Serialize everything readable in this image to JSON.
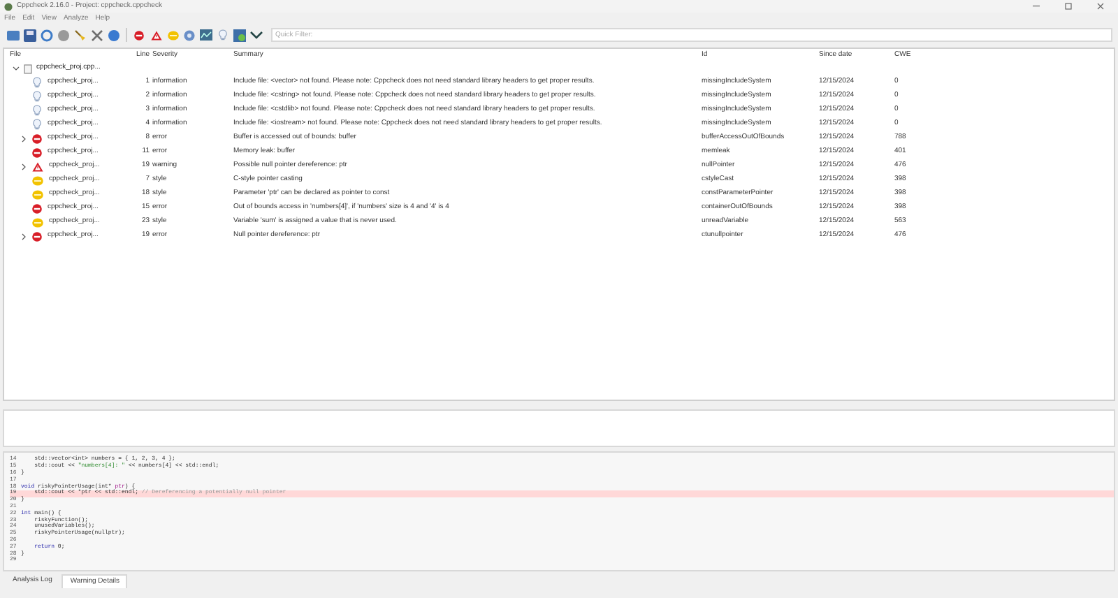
{
  "window": {
    "title": "Cppcheck 2.16.0 - Project: cppcheck.cppcheck"
  },
  "menu": [
    "File",
    "Edit",
    "View",
    "Analyze",
    "Help"
  ],
  "quick_filter": {
    "placeholder": "Quick Filter:"
  },
  "table": {
    "columns": [
      "File",
      "Line",
      "Severity",
      "Summary",
      "Id",
      "Since date",
      "CWE"
    ],
    "group": {
      "file": "cppcheck_proj.cpp...",
      "expanded": true
    },
    "rows": [
      {
        "kind": "information",
        "expandable": false,
        "file": "cppcheck_proj...",
        "line": "1",
        "severity": "information",
        "summary": "Include file: <vector> not found. Please note: Cppcheck does not need standard library headers to get proper results.",
        "id": "missingIncludeSystem",
        "since": "12/15/2024",
        "cwe": "0"
      },
      {
        "kind": "information",
        "expandable": false,
        "file": "cppcheck_proj...",
        "line": "2",
        "severity": "information",
        "summary": "Include file: <cstring> not found. Please note: Cppcheck does not need standard library headers to get proper results.",
        "id": "missingIncludeSystem",
        "since": "12/15/2024",
        "cwe": "0"
      },
      {
        "kind": "information",
        "expandable": false,
        "file": "cppcheck_proj...",
        "line": "3",
        "severity": "information",
        "summary": "Include file: <cstdlib> not found. Please note: Cppcheck does not need standard library headers to get proper results.",
        "id": "missingIncludeSystem",
        "since": "12/15/2024",
        "cwe": "0"
      },
      {
        "kind": "information",
        "expandable": false,
        "file": "cppcheck_proj...",
        "line": "4",
        "severity": "information",
        "summary": "Include file: <iostream> not found. Please note: Cppcheck does not need standard library headers to get proper results.",
        "id": "missingIncludeSystem",
        "since": "12/15/2024",
        "cwe": "0"
      },
      {
        "kind": "error",
        "expandable": true,
        "file": "cppcheck_proj...",
        "line": "8",
        "severity": "error",
        "summary": "Buffer is accessed out of bounds: buffer",
        "id": "bufferAccessOutOfBounds",
        "since": "12/15/2024",
        "cwe": "788"
      },
      {
        "kind": "error",
        "expandable": false,
        "file": "cppcheck_proj...",
        "line": "11",
        "severity": "error",
        "summary": "Memory leak: buffer",
        "id": "memleak",
        "since": "12/15/2024",
        "cwe": "401"
      },
      {
        "kind": "warning",
        "expandable": true,
        "file": "cppcheck_proj...",
        "line": "19",
        "severity": "warning",
        "summary": "Possible null pointer dereference: ptr",
        "id": "nullPointer",
        "since": "12/15/2024",
        "cwe": "476"
      },
      {
        "kind": "style",
        "expandable": false,
        "file": "cppcheck_proj...",
        "line": "7",
        "severity": "style",
        "summary": "C-style pointer casting",
        "id": "cstyleCast",
        "since": "12/15/2024",
        "cwe": "398"
      },
      {
        "kind": "style",
        "expandable": false,
        "file": "cppcheck_proj...",
        "line": "18",
        "severity": "style",
        "summary": "Parameter 'ptr' can be declared as pointer to const",
        "id": "constParameterPointer",
        "since": "12/15/2024",
        "cwe": "398"
      },
      {
        "kind": "error",
        "expandable": false,
        "file": "cppcheck_proj...",
        "line": "15",
        "severity": "error",
        "summary": "Out of bounds access in 'numbers[4]', if 'numbers' size is 4 and '4' is 4",
        "id": "containerOutOfBounds",
        "since": "12/15/2024",
        "cwe": "398"
      },
      {
        "kind": "style",
        "expandable": false,
        "file": "cppcheck_proj...",
        "line": "23",
        "severity": "style",
        "summary": "Variable 'sum' is assigned a value that is never used.",
        "id": "unreadVariable",
        "since": "12/15/2024",
        "cwe": "563"
      },
      {
        "kind": "error",
        "expandable": true,
        "file": "cppcheck_proj...",
        "line": "19",
        "severity": "error",
        "summary": "Null pointer dereference: ptr",
        "id": "ctunullpointer",
        "since": "12/15/2024",
        "cwe": "476"
      }
    ]
  },
  "code": [
    {
      "number": "14",
      "highlighted": false,
      "tokens": [
        {
          "kind": "plain",
          "text": "    std::vector<int> numbers = { 1, 2, 3, 4 };"
        }
      ]
    },
    {
      "number": "15",
      "highlighted": false,
      "tokens": [
        {
          "kind": "plain",
          "text": "    std::cout << "
        },
        {
          "kind": "string",
          "text": "\"numbers[4]: \""
        },
        {
          "kind": "plain",
          "text": " << numbers[4] << std::endl;"
        }
      ]
    },
    {
      "number": "16",
      "highlighted": false,
      "tokens": [
        {
          "kind": "plain",
          "text": "}"
        }
      ]
    },
    {
      "number": "17",
      "highlighted": false
    },
    {
      "number": "18",
      "highlighted": false,
      "tokens": [
        {
          "kind": "keyword",
          "text": "void"
        },
        {
          "kind": "plain",
          "text": " riskyPointerUsage(int* "
        },
        {
          "kind": "param",
          "text": "ptr"
        },
        {
          "kind": "plain",
          "text": ") {"
        }
      ]
    },
    {
      "number": "19",
      "highlighted": true,
      "tokens": [
        {
          "kind": "plain",
          "text": "    std::cout << *ptr << std::endl; "
        },
        {
          "kind": "comment",
          "text": "// Dereferencing a potentially null pointer"
        }
      ]
    },
    {
      "number": "20",
      "highlighted": false,
      "tokens": [
        {
          "kind": "plain",
          "text": "}"
        }
      ]
    },
    {
      "number": "21",
      "highlighted": false
    },
    {
      "number": "22",
      "highlighted": false,
      "tokens": [
        {
          "kind": "keyword",
          "text": "int"
        },
        {
          "kind": "plain",
          "text": " main() {"
        }
      ]
    },
    {
      "number": "23",
      "highlighted": false,
      "tokens": [
        {
          "kind": "plain",
          "text": "    riskyFunction();"
        }
      ]
    },
    {
      "number": "24",
      "highlighted": false,
      "tokens": [
        {
          "kind": "plain",
          "text": "    unusedVariables();"
        }
      ]
    },
    {
      "number": "25",
      "highlighted": false,
      "tokens": [
        {
          "kind": "plain",
          "text": "    riskyPointerUsage(nullptr);"
        }
      ]
    },
    {
      "number": "26",
      "highlighted": false
    },
    {
      "number": "27",
      "highlighted": false,
      "tokens": [
        {
          "kind": "keyword",
          "text": "    return"
        },
        {
          "kind": "plain",
          "text": " 0;"
        }
      ]
    },
    {
      "number": "28",
      "highlighted": false,
      "tokens": [
        {
          "kind": "plain",
          "text": "}"
        }
      ]
    },
    {
      "number": "29",
      "highlighted": false
    }
  ],
  "bottom_tabs": [
    {
      "label": "Analysis Log",
      "selected": false
    },
    {
      "label": "Warning Details",
      "selected": true
    }
  ]
}
